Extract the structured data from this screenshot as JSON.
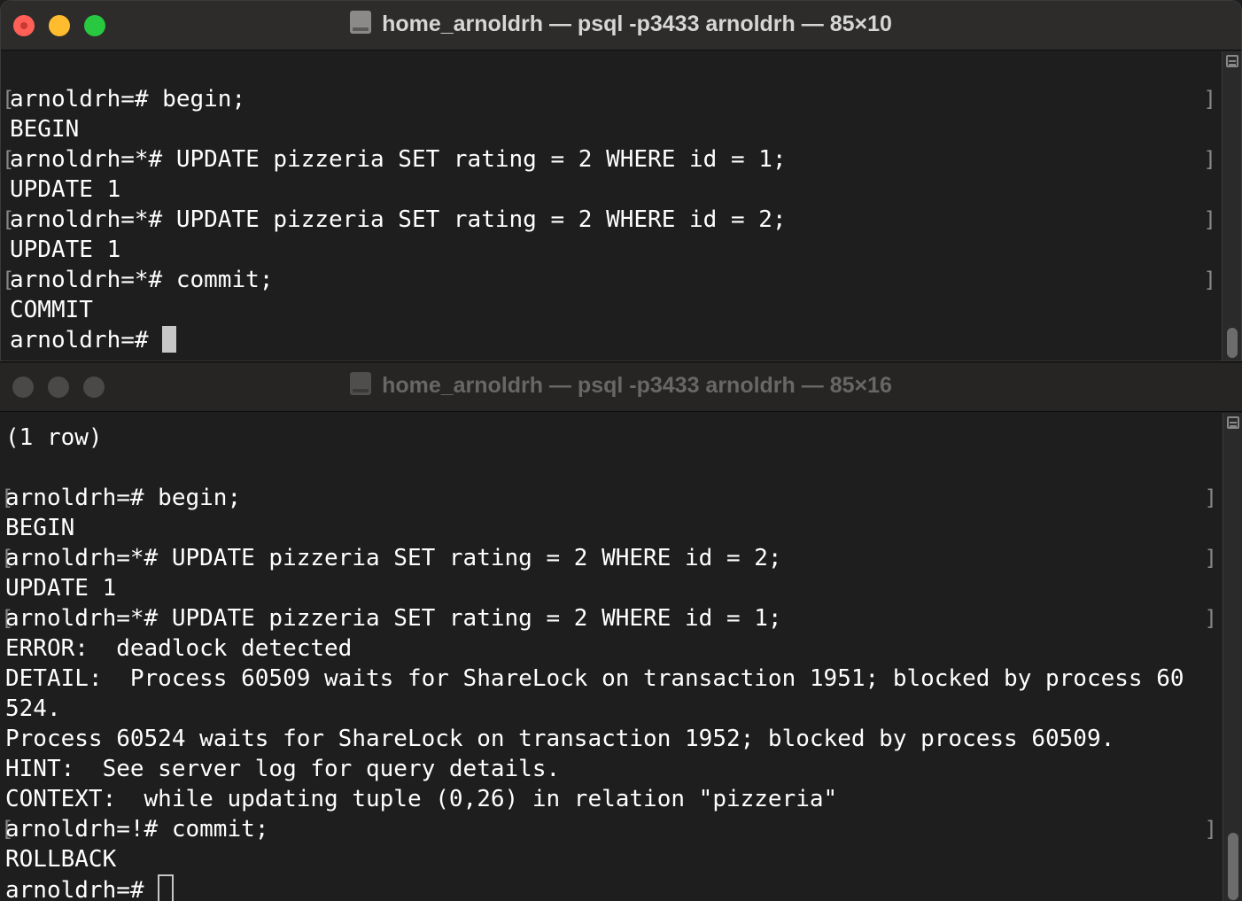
{
  "top_window": {
    "title": "home_arnoldrh — psql -p3433 arnoldrh — 85×10",
    "lines": [
      {
        "text": "",
        "bracket": false
      },
      {
        "text": "arnoldrh=# begin;",
        "bracket": true
      },
      {
        "text": "BEGIN",
        "bracket": false
      },
      {
        "text": "arnoldrh=*# UPDATE pizzeria SET rating = 2 WHERE id = 1;",
        "bracket": true
      },
      {
        "text": "UPDATE 1",
        "bracket": false
      },
      {
        "text": "arnoldrh=*# UPDATE pizzeria SET rating = 2 WHERE id = 2;",
        "bracket": true
      },
      {
        "text": "UPDATE 1",
        "bracket": false
      },
      {
        "text": "arnoldrh=*# commit;",
        "bracket": true
      },
      {
        "text": "COMMIT",
        "bracket": false
      }
    ],
    "prompt": "arnoldrh=# "
  },
  "bottom_window": {
    "title": "home_arnoldrh — psql -p3433 arnoldrh — 85×16",
    "lines": [
      {
        "text": "(1 row)",
        "bracket": false
      },
      {
        "text": "",
        "bracket": false
      },
      {
        "text": "arnoldrh=# begin;",
        "bracket": true
      },
      {
        "text": "BEGIN",
        "bracket": false
      },
      {
        "text": "arnoldrh=*# UPDATE pizzeria SET rating = 2 WHERE id = 2;",
        "bracket": true
      },
      {
        "text": "UPDATE 1",
        "bracket": false
      },
      {
        "text": "arnoldrh=*# UPDATE pizzeria SET rating = 2 WHERE id = 1;",
        "bracket": true
      },
      {
        "text": "ERROR:  deadlock detected",
        "bracket": false
      },
      {
        "text": "DETAIL:  Process 60509 waits for ShareLock on transaction 1951; blocked by process 60",
        "bracket": false
      },
      {
        "text": "524.",
        "bracket": false
      },
      {
        "text": "Process 60524 waits for ShareLock on transaction 1952; blocked by process 60509.",
        "bracket": false
      },
      {
        "text": "HINT:  See server log for query details.",
        "bracket": false
      },
      {
        "text": "CONTEXT:  while updating tuple (0,26) in relation \"pizzeria\"",
        "bracket": false
      },
      {
        "text": "arnoldrh=!# commit;",
        "bracket": true
      },
      {
        "text": "ROLLBACK",
        "bracket": false
      }
    ],
    "prompt": "arnoldrh=# "
  }
}
